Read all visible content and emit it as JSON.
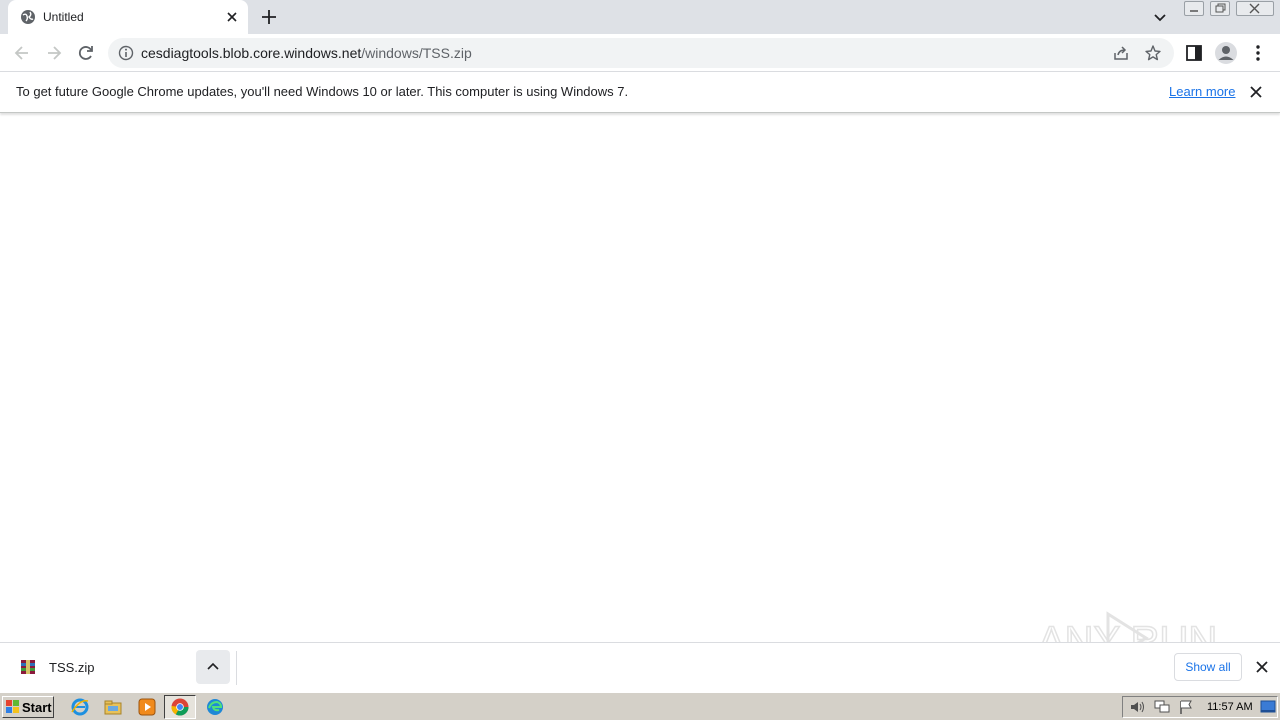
{
  "tab": {
    "title": "Untitled"
  },
  "omnibox": {
    "host": "cesdiagtools.blob.core.windows.net",
    "path": "/windows/TSS.zip"
  },
  "infobar": {
    "message": "To get future Google Chrome updates, you'll need Windows 10 or later. This computer is using Windows 7.",
    "link": "Learn more"
  },
  "downloads": {
    "file_name": "TSS.zip",
    "show_all": "Show all"
  },
  "watermark": {
    "text": "ANY RUN"
  },
  "taskbar": {
    "start_label": "Start",
    "clock": "11:57 AM"
  },
  "colors": {
    "accent": "#1a73e8",
    "tabstrip": "#dee1e6",
    "taskbar": "#d4d0c8"
  }
}
